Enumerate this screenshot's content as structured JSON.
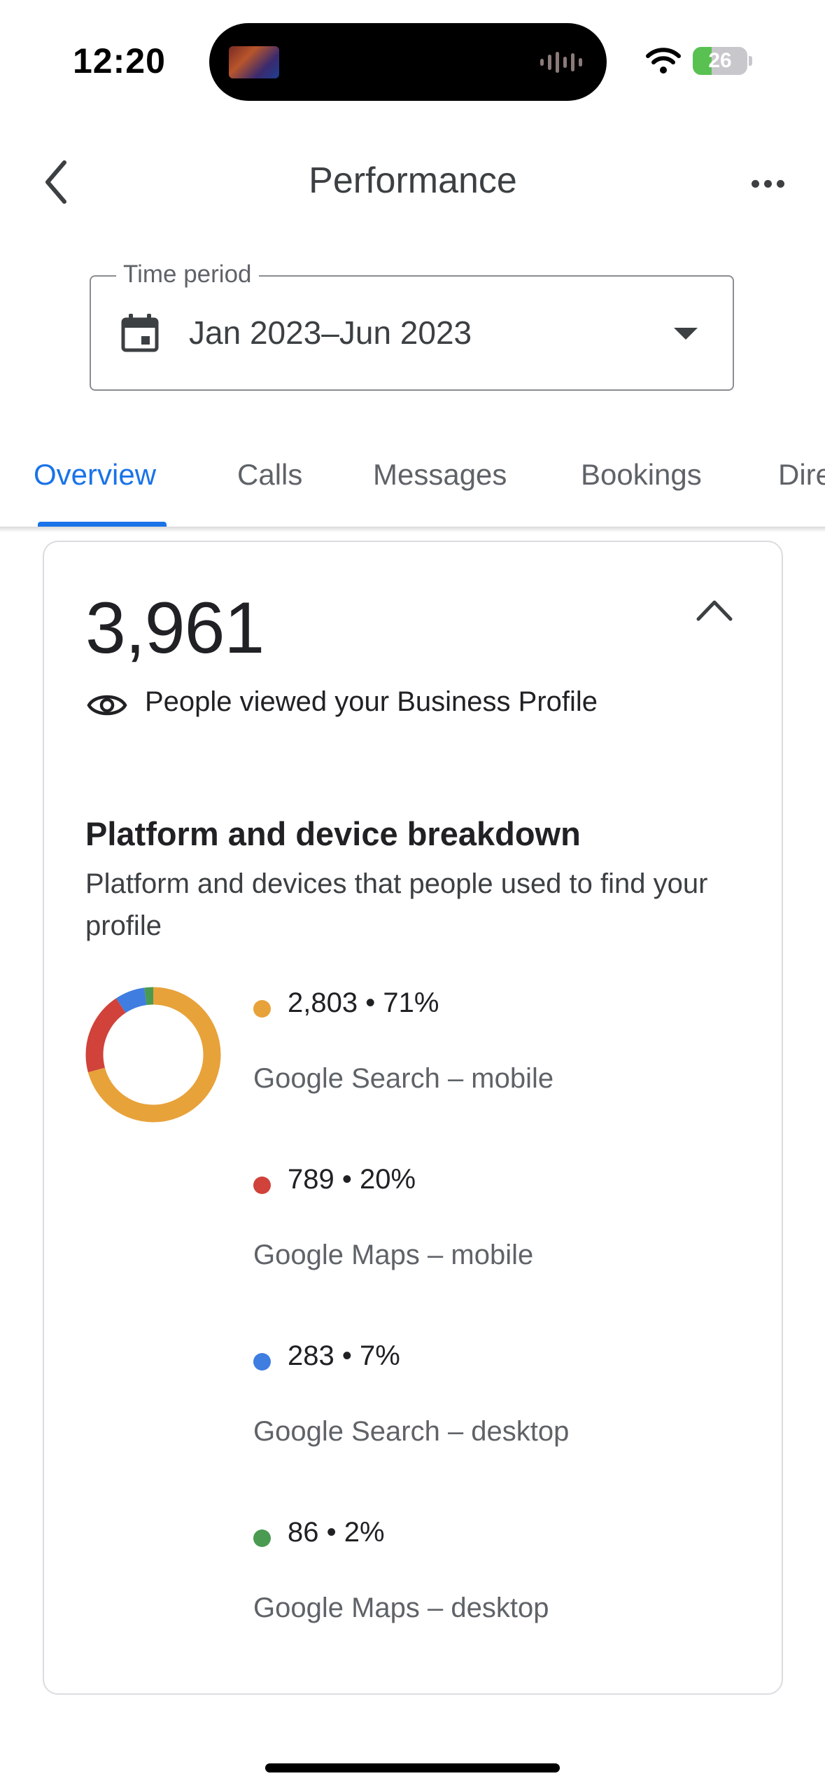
{
  "status_bar": {
    "time": "12:20",
    "battery": "26"
  },
  "header": {
    "title": "Performance"
  },
  "time_period": {
    "label": "Time period",
    "value": "Jan 2023–Jun 2023"
  },
  "tabs": [
    {
      "label": "Overview",
      "active": true
    },
    {
      "label": "Calls",
      "active": false
    },
    {
      "label": "Messages",
      "active": false
    },
    {
      "label": "Bookings",
      "active": false
    },
    {
      "label": "Dire",
      "active": false
    }
  ],
  "summary": {
    "count": "3,961",
    "caption": "People viewed your Business Profile"
  },
  "breakdown": {
    "title": "Platform and device breakdown",
    "subtitle": "Platform and devices that people used to find your profile"
  },
  "chart_data": {
    "type": "pie",
    "title": "",
    "slices": [
      {
        "name": "Google Search – mobile",
        "value": 2803,
        "percent": 71,
        "display": "2,803 • 71%",
        "color": "#e8a23a"
      },
      {
        "name": "Google Maps – mobile",
        "value": 789,
        "percent": 20,
        "display": "789 • 20%",
        "color": "#d0423a"
      },
      {
        "name": "Google Search – desktop",
        "value": 283,
        "percent": 7,
        "display": "283 • 7%",
        "color": "#3f7de0"
      },
      {
        "name": "Google Maps – desktop",
        "value": 86,
        "percent": 2,
        "display": "86 • 2%",
        "color": "#4a9a52"
      }
    ]
  },
  "icons": {
    "back": "chevron-left-icon",
    "more": "more-horizontal-icon",
    "calendar": "calendar-icon",
    "dropdown": "arrow-drop-down-icon",
    "collapse": "chevron-up-icon",
    "views": "eye-icon"
  }
}
